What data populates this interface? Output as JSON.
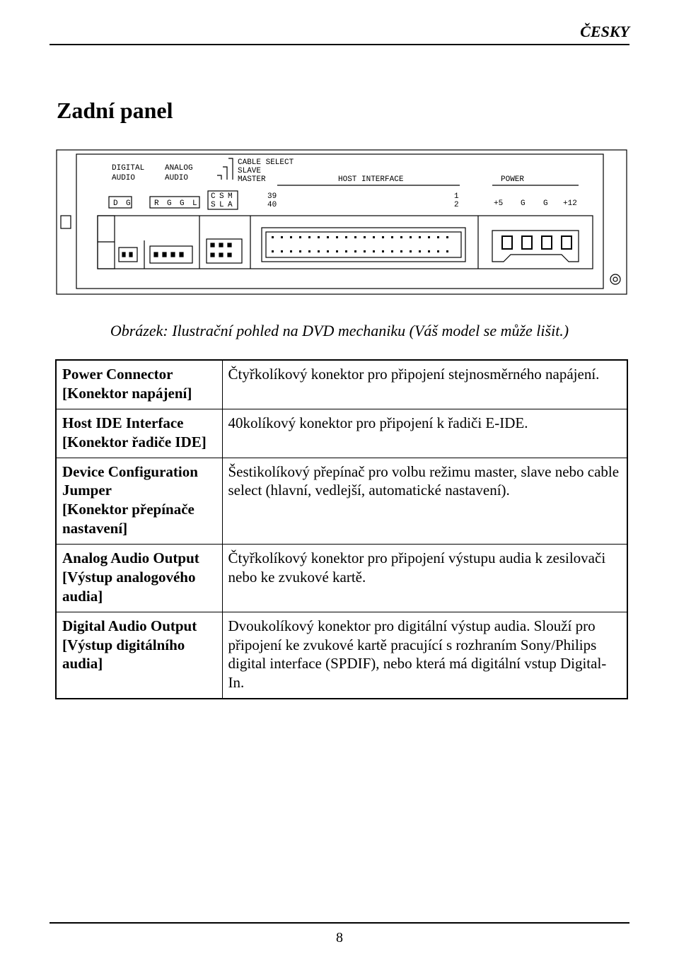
{
  "lang_tag": "ČESKY",
  "page_title": "Zadní panel",
  "caption": "Obrázek: Ilustrační pohled na DVD mechaniku  (Váš model se může lišit.)",
  "diagram": {
    "labels": {
      "digital_audio": "DIGITAL",
      "analog_audio": "ANALOG",
      "audio1": "AUDIO",
      "audio2": "AUDIO",
      "cable_select": "CABLE SELECT",
      "slave": "SLAVE",
      "master": "MASTER",
      "host_interface": "HOST INTERFACE",
      "power": "POWER",
      "d": "D",
      "g_d": "G",
      "r": "R",
      "g_a1": "G",
      "g_a2": "G",
      "l": "L",
      "c": "C",
      "s": "S",
      "m": "M",
      "s2": "S",
      "l2": "L",
      "a": "A",
      "n39": "39",
      "n40": "40",
      "n1": "1",
      "n2": "2",
      "p5": "+5",
      "pg1": "G",
      "pg2": "G",
      "p12": "+12"
    }
  },
  "rows": [
    {
      "term": "Power Connector",
      "sub": "[Konektor napájení]",
      "desc": "Čtyřkolíkový konektor pro připojení stejnosměrného napájení."
    },
    {
      "term": "Host IDE Interface",
      "sub": "[Konektor řadiče IDE]",
      "desc": "40kolíkový konektor pro připojení k řadiči E-IDE."
    },
    {
      "term": "Device Configuration Jumper",
      "sub": "[Konektor přepínače nastavení]",
      "desc": "Šestikolíkový přepínač pro volbu režimu master, slave nebo cable select (hlavní, vedlejší, automatické nastavení)."
    },
    {
      "term": "Analog Audio Output",
      "sub": "[Výstup analogového audia]",
      "desc": "Čtyřkolíkový konektor pro připojení výstupu audia k zesilovači nebo ke zvukové kartě."
    },
    {
      "term": "Digital Audio Output",
      "sub": "[Výstup digitálního audia]",
      "desc": "Dvoukolíkový konektor pro digitální výstup audia. Slouží pro připojení ke zvukové kartě pracující s rozhraním Sony/Philips digital interface (SPDIF), nebo která má digitální vstup Digital-In."
    }
  ],
  "page_number": "8"
}
